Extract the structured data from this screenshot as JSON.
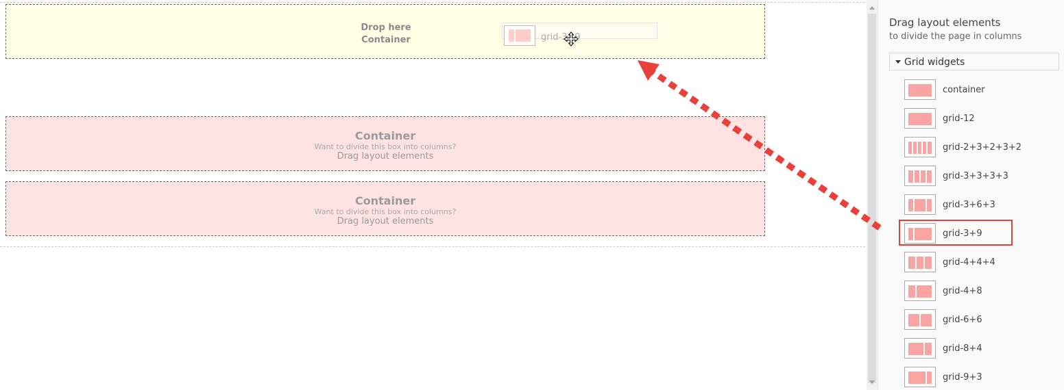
{
  "canvas": {
    "drop_box": {
      "line1": "Drop here",
      "line2": "Container"
    },
    "drag_ghost_label": "grid-3+9",
    "containers": [
      {
        "title": "Container",
        "subtitle": "Want to divide this box into columns?",
        "hint": "Drag layout elements"
      },
      {
        "title": "Container",
        "subtitle": "Want to divide this box into columns?",
        "hint": "Drag layout elements"
      }
    ]
  },
  "sidebar": {
    "title": "Drag layout elements",
    "subtitle": "to divide the page in columns",
    "section_label": "Grid widgets",
    "widgets": [
      {
        "label": "container",
        "icon": "layout-container-icon"
      },
      {
        "label": "grid-12",
        "icon": "layout-grid-12-icon"
      },
      {
        "label": "grid-2+3+2+3+2",
        "icon": "layout-grid-2-3-2-3-2-icon"
      },
      {
        "label": "grid-3+3+3+3",
        "icon": "layout-grid-3-3-3-3-icon"
      },
      {
        "label": "grid-3+6+3",
        "icon": "layout-grid-3-6-3-icon"
      },
      {
        "label": "grid-3+9",
        "icon": "layout-grid-3-9-icon",
        "highlighted": true
      },
      {
        "label": "grid-4+4+4",
        "icon": "layout-grid-4-4-4-icon"
      },
      {
        "label": "grid-4+8",
        "icon": "layout-grid-4-8-icon"
      },
      {
        "label": "grid-6+6",
        "icon": "layout-grid-6-6-icon"
      },
      {
        "label": "grid-8+4",
        "icon": "layout-grid-8-4-icon"
      },
      {
        "label": "grid-9+3",
        "icon": "layout-grid-9-3-icon"
      }
    ]
  },
  "colors": {
    "drop_zone_bg": "#fefee4",
    "container_bg": "#ffe3e3",
    "widget_fill": "#f9a3a3",
    "highlight": "#e0403a",
    "arrow": "#e8403a"
  }
}
